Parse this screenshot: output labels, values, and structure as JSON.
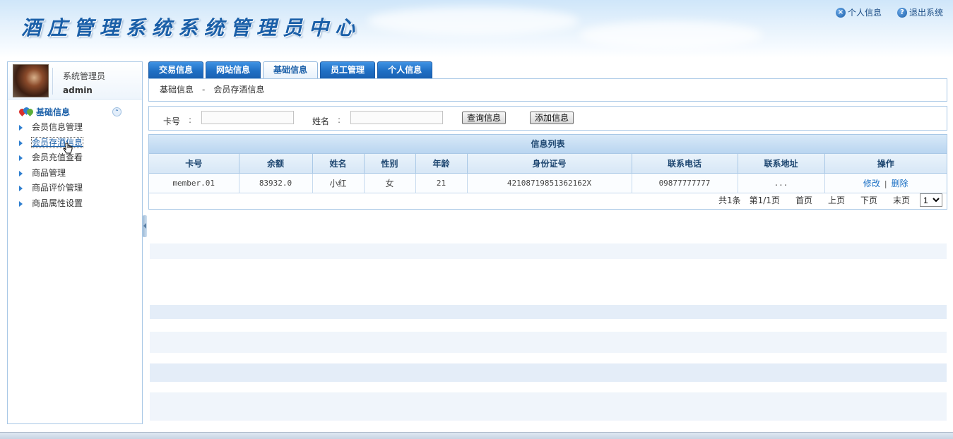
{
  "header": {
    "title": "酒庄管理系统系统管理员中心",
    "links": [
      {
        "label": "个人信息",
        "icon": "close-circle-icon"
      },
      {
        "label": "退出系统",
        "icon": "help-circle-icon"
      }
    ]
  },
  "user": {
    "role": "系统管理员",
    "name": "admin"
  },
  "menu": {
    "head": "基础信息",
    "items": [
      {
        "label": "会员信息管理"
      },
      {
        "label": "会员存酒信息"
      },
      {
        "label": "会员充值查看"
      },
      {
        "label": "商品管理"
      },
      {
        "label": "商品评价管理"
      },
      {
        "label": "商品属性设置"
      }
    ]
  },
  "tabs": [
    "交易信息",
    "网站信息",
    "基础信息",
    "员工管理",
    "个人信息"
  ],
  "breadcrumb": {
    "part1": "基础信息",
    "separator": "-",
    "part2": "会员存酒信息"
  },
  "search": {
    "card_label": "卡号",
    "name_label": "姓名",
    "colon": ":",
    "card_value": "",
    "name_value": "",
    "query_button": "查询信息",
    "add_button": "添加信息"
  },
  "table": {
    "title": "信息列表",
    "columns": [
      "卡号",
      "余额",
      "姓名",
      "性别",
      "年龄",
      "身份证号",
      "联系电话",
      "联系地址",
      "操作"
    ],
    "rows": [
      {
        "card": "member.01",
        "balance": "83932.0",
        "name": "小红",
        "gender": "女",
        "age": "21",
        "id_number": "42108719851362162X",
        "phone": "09877777777",
        "address": "...",
        "edit": "修改",
        "op_sep": "|",
        "delete": "删除"
      }
    ]
  },
  "pager": {
    "total": "共1条",
    "page": "第1/1页",
    "first": "首页",
    "prev": "上页",
    "next": "下页",
    "last": "末页",
    "selected": "1"
  },
  "colors": {
    "accent": "#1a5fa8",
    "tab": "#1f6fc4",
    "border": "#a9c8e6"
  }
}
